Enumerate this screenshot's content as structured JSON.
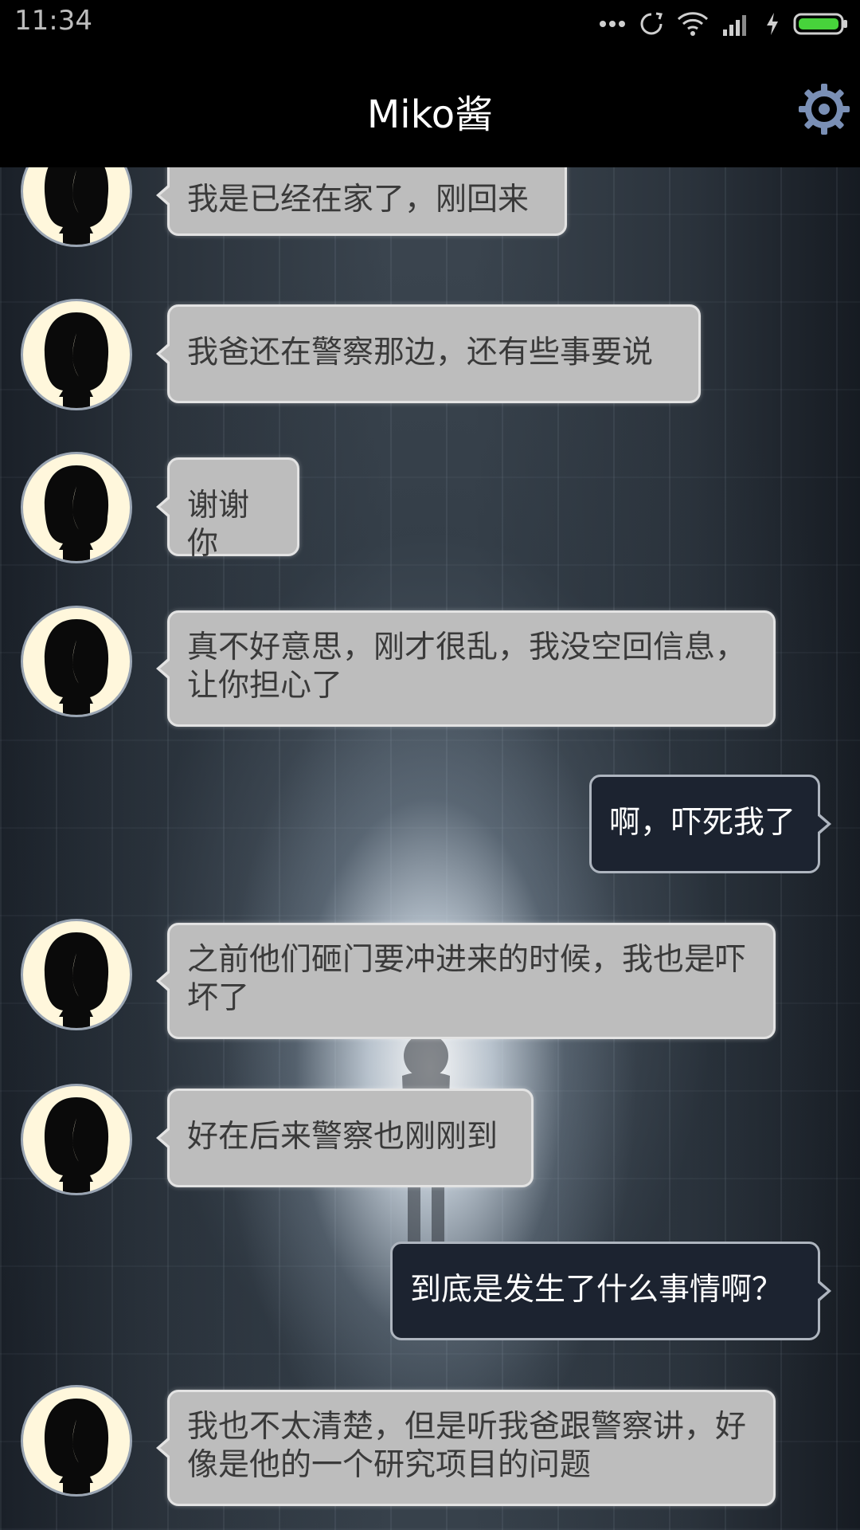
{
  "status_bar": {
    "time": "11:34",
    "icons": [
      "more-dots-icon",
      "sync-icon",
      "wifi-icon",
      "signal-icon",
      "charging-icon",
      "battery-icon"
    ]
  },
  "header": {
    "title": "Miko酱",
    "settings_icon": "gear-icon"
  },
  "colors": {
    "incoming_bubble": "#bdbdbd",
    "outgoing_bubble": "#1c2330",
    "avatar_bg": "#fff7dc",
    "settings_gear": "#7a8fb5"
  },
  "messages": [
    {
      "from": "miko",
      "text": "我是已经在家了，刚回来"
    },
    {
      "from": "miko",
      "text": "我爸还在警察那边，还有些事要说"
    },
    {
      "from": "miko",
      "text": "谢谢你"
    },
    {
      "from": "miko",
      "text": "真不好意思，刚才很乱，我没空回信息，让你担心了"
    },
    {
      "from": "me",
      "text": "啊，吓死我了"
    },
    {
      "from": "miko",
      "text": "之前他们砸门要冲进来的时候，我也是吓坏了"
    },
    {
      "from": "miko",
      "text": "好在后来警察也刚刚到"
    },
    {
      "from": "me",
      "text": "到底是发生了什么事情啊？"
    },
    {
      "from": "miko",
      "text": "我也不太清楚，但是听我爸跟警察讲，好像是他的一个研究项目的问题"
    }
  ]
}
